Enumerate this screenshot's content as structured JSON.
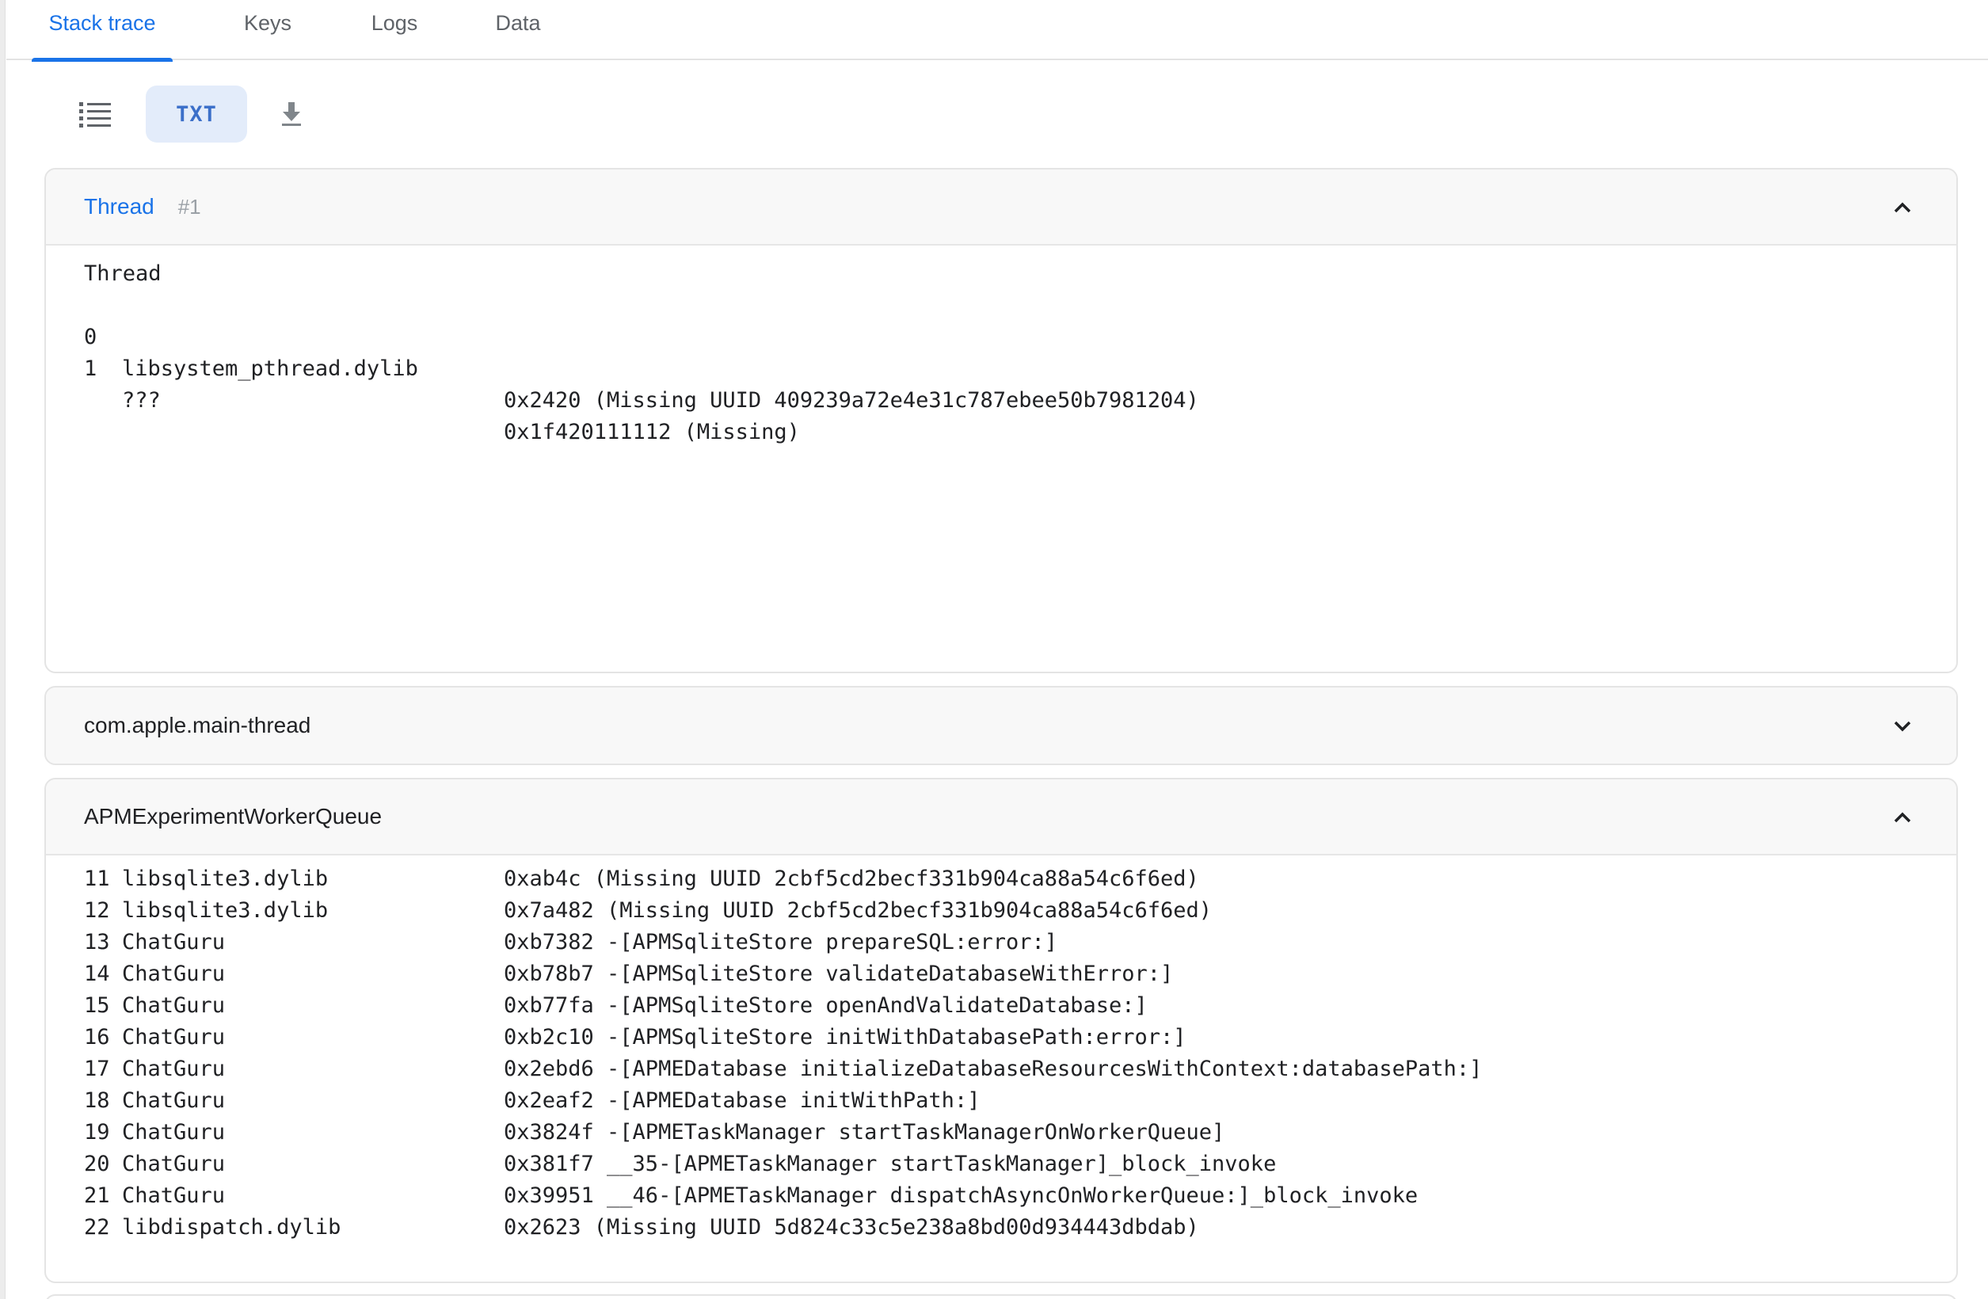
{
  "tabs": [
    {
      "label": "Stack trace",
      "active": true
    },
    {
      "label": "Keys",
      "active": false
    },
    {
      "label": "Logs",
      "active": false
    },
    {
      "label": "Data",
      "active": false
    }
  ],
  "toolbar": {
    "list_icon": "list-icon",
    "txt_label": "TXT",
    "download_icon": "download-icon",
    "active_bg": "#e3ecfa"
  },
  "threads": [
    {
      "title": "Thread",
      "subtitle": "#1",
      "expanded": true,
      "body_header": "Thread",
      "frames": [
        {
          "idx": "0",
          "lib": "libsystem_pthread.dylib",
          "sym": "0x2420 (Missing UUID 409239a72e4e31c787ebee50b7981204)"
        },
        {
          "idx": "1",
          "lib": "???",
          "sym": "0x1f420111112 (Missing)"
        }
      ]
    },
    {
      "title": "com.apple.main-thread",
      "expanded": false
    },
    {
      "title": "APMExperimentWorkerQueue",
      "expanded": true,
      "frames": [
        {
          "idx": "11",
          "lib": "libsqlite3.dylib",
          "sym": "0xab4c (Missing UUID 2cbf5cd2becf331b904ca88a54c6f6ed)"
        },
        {
          "idx": "12",
          "lib": "libsqlite3.dylib",
          "sym": "0x7a482 (Missing UUID 2cbf5cd2becf331b904ca88a54c6f6ed)"
        },
        {
          "idx": "13",
          "lib": "ChatGuru",
          "sym": "0xb7382 -[APMSqliteStore prepareSQL:error:]"
        },
        {
          "idx": "14",
          "lib": "ChatGuru",
          "sym": "0xb78b7 -[APMSqliteStore validateDatabaseWithError:]"
        },
        {
          "idx": "15",
          "lib": "ChatGuru",
          "sym": "0xb77fa -[APMSqliteStore openAndValidateDatabase:]"
        },
        {
          "idx": "16",
          "lib": "ChatGuru",
          "sym": "0xb2c10 -[APMSqliteStore initWithDatabasePath:error:]"
        },
        {
          "idx": "17",
          "lib": "ChatGuru",
          "sym": "0x2ebd6 -[APMEDatabase initializeDatabaseResourcesWithContext:databasePath:]"
        },
        {
          "idx": "18",
          "lib": "ChatGuru",
          "sym": "0x2eaf2 -[APMEDatabase initWithPath:]"
        },
        {
          "idx": "19",
          "lib": "ChatGuru",
          "sym": "0x3824f -[APMETaskManager startTaskManagerOnWorkerQueue]"
        },
        {
          "idx": "20",
          "lib": "ChatGuru",
          "sym": "0x381f7 __35-[APMETaskManager startTaskManager]_block_invoke"
        },
        {
          "idx": "21",
          "lib": "ChatGuru",
          "sym": "0x39951 __46-[APMETaskManager dispatchAsyncOnWorkerQueue:]_block_invoke"
        },
        {
          "idx": "22",
          "lib": "libdispatch.dylib",
          "sym": "0x2623 (Missing UUID 5d824c33c5e238a8bd00d934443dbdab)"
        }
      ]
    }
  ],
  "colors": {
    "accent": "#1a73e8",
    "muted": "#5f6368",
    "header_bg": "#f8f8f8"
  }
}
